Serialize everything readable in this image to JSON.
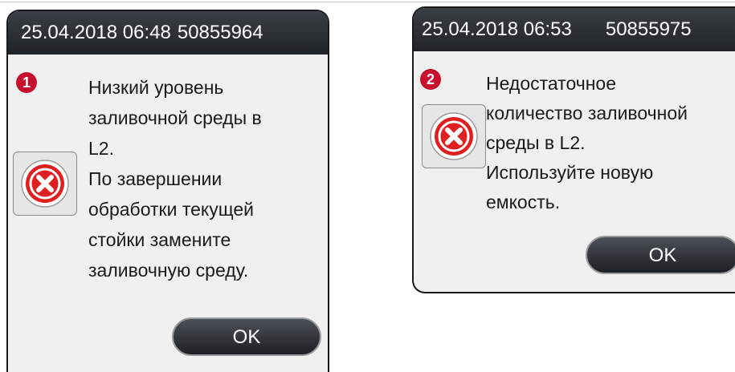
{
  "dialogs": [
    {
      "number": "1",
      "timestamp": "25.04.2018 06:48",
      "id": "50855964",
      "icon": "error-x-icon",
      "message_lines": [
        "Низкий уровень",
        "заливочной среды в",
        "L2.",
        "По завершении",
        "обработки текущей",
        "стойки замените",
        "заливочную среду."
      ],
      "ok_label": "OK"
    },
    {
      "number": "2",
      "timestamp": "25.04.2018 06:53",
      "id": "50855975",
      "icon": "error-x-icon",
      "message_lines": [
        "Недостаточное",
        "количество заливочной",
        "среды в L2.",
        "Используйте новую",
        "емкость."
      ],
      "ok_label": "OK"
    }
  ],
  "colors": {
    "titlebar": "#202428",
    "dialog_bg": "#f0f0f0",
    "badge": "#c8102e",
    "error_icon": "#e02020"
  }
}
